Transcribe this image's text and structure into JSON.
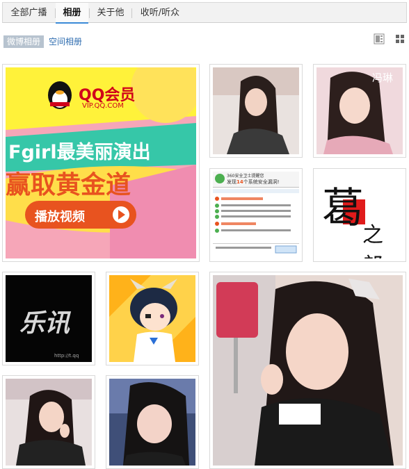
{
  "tabs": [
    {
      "label": "全部广播"
    },
    {
      "label": "相册"
    },
    {
      "label": "关于他"
    },
    {
      "label": "收听/听众"
    }
  ],
  "albums": {
    "weibo": "微博相册",
    "space": "空间相册"
  },
  "ad": {
    "brand": "QQ会员",
    "url": "VIP.QQ.COM",
    "line1": "Fgirl最美丽演出",
    "line2": "赢取黄金道",
    "button": "播放视频"
  },
  "photo_texts": {
    "name_tag": "冯琳",
    "calligraphy": "葛",
    "seal": "之郎",
    "logo": "乐讯",
    "watermark": "http://t.qq"
  },
  "screenshot": {
    "title": "360安全卫士提醒您",
    "found_prefix": "发现",
    "count": "14",
    "found_suffix": "个系统安全漏洞!"
  },
  "colors": {
    "tab_active": "#3a8ad7",
    "link": "#2f6db0",
    "chip_bg": "#b7c3cf"
  }
}
